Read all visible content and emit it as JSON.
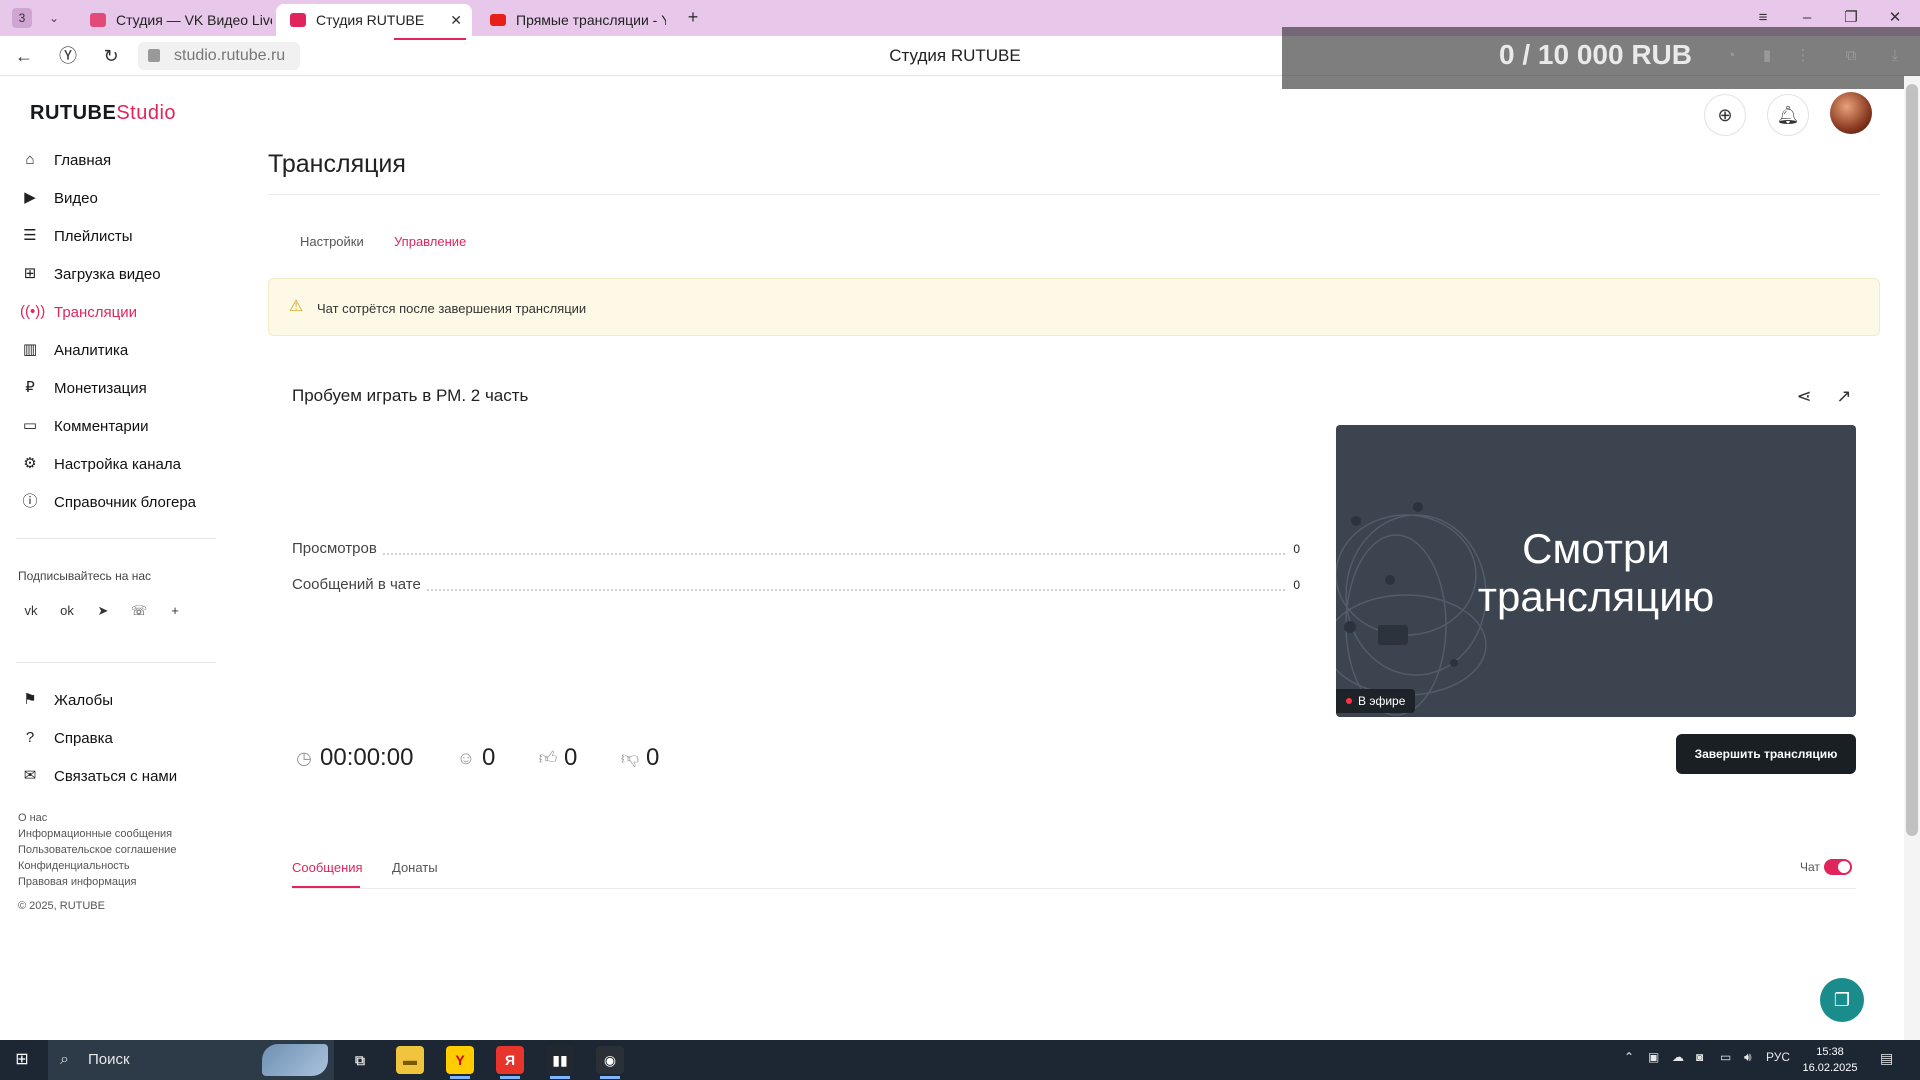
{
  "browser": {
    "tab_count": "3",
    "tabs": [
      {
        "title": "Студия — VK Видео Live",
        "active": false
      },
      {
        "title": "Студия RUTUBE",
        "active": true
      },
      {
        "title": "Прямые трансляции - Yo",
        "active": false
      }
    ],
    "url": "studio.rutube.ru",
    "page_title": "Студия RUTUBE",
    "overlay_counter": "0 / 10 000 RUB"
  },
  "header": {
    "logo_main": "RUTUBE",
    "logo_sub": "Studio"
  },
  "sidebar": {
    "items": [
      {
        "label": "Главная",
        "icon": "home-icon"
      },
      {
        "label": "Видео",
        "icon": "video-icon"
      },
      {
        "label": "Плейлисты",
        "icon": "playlist-icon"
      },
      {
        "label": "Загрузка видео",
        "icon": "upload-icon"
      },
      {
        "label": "Трансляции",
        "icon": "broadcast-icon",
        "active": true
      },
      {
        "label": "Аналитика",
        "icon": "analytics-icon"
      },
      {
        "label": "Монетизация",
        "icon": "ruble-icon"
      },
      {
        "label": "Комментарии",
        "icon": "comments-icon"
      },
      {
        "label": "Настройка канала",
        "icon": "gear-icon"
      },
      {
        "label": "Справочник блогера",
        "icon": "info-icon"
      }
    ],
    "follow_label": "Подписывайтесь на нас",
    "social": [
      "vk-icon",
      "odnoklassniki-icon",
      "telegram-icon",
      "viber-icon",
      "plus-icon"
    ],
    "support_items": [
      {
        "label": "Жалобы",
        "icon": "flag-icon"
      },
      {
        "label": "Справка",
        "icon": "help-icon"
      },
      {
        "label": "Связаться с нами",
        "icon": "mail-icon"
      }
    ],
    "footer_links": [
      "О нас",
      "Информационные сообщения",
      "Пользовательское соглашение",
      "Конфиденциальность",
      "Правовая информация"
    ],
    "copyright": "© 2025, RUTUBE"
  },
  "main": {
    "title": "Трансляция",
    "tabs": [
      {
        "label": "Настройки",
        "active": false
      },
      {
        "label": "Управление",
        "active": true
      }
    ],
    "alert_text": "Чат сотрётся после завершения трансляции",
    "stream": {
      "name": "Пробуем играть в РМ. 2 часть",
      "stats": [
        {
          "label": "Просмотров",
          "value": "0"
        },
        {
          "label": "Сообщений в чате",
          "value": "0"
        }
      ],
      "duration": "00:00:00",
      "viewers": "0",
      "likes": "0",
      "dislikes": "0",
      "preview_text_line1": "Смотри",
      "preview_text_line2": "трансляцию",
      "live_badge": "В эфире",
      "end_button": "Завершить трансляцию"
    },
    "chat": {
      "tabs": [
        {
          "label": "Сообщения",
          "active": true
        },
        {
          "label": "Донаты",
          "active": false
        }
      ],
      "toggle_label": "Чат",
      "toggle_on": true
    }
  },
  "taskbar": {
    "search_placeholder": "Поиск",
    "language": "РУС",
    "time": "15:38",
    "date": "16.02.2025"
  },
  "colors": {
    "accent": "#e2245c",
    "tab_strip": "#e8c8ea",
    "preview_bg": "#3b444f",
    "taskbar": "#1c2733"
  }
}
